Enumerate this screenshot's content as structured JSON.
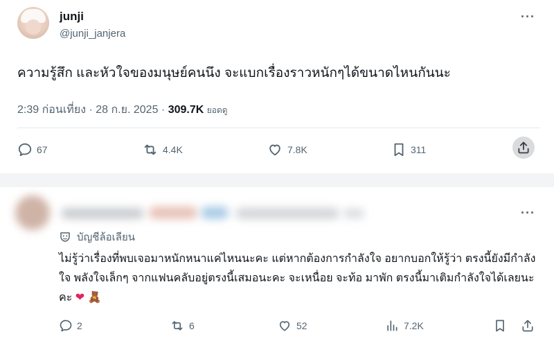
{
  "tweet": {
    "author_name": "junji",
    "author_handle": "@junji_janjera",
    "text": "ความรู้สึก และหัวใจของมนุษย์คนนึง จะแบกเรื่องราวหนักๆได้ขนาดไหนกันนะ",
    "timestamp": "2:39 ก่อนเที่ยง · 28 ก.ย. 2025 · ",
    "views_count": "309.7K",
    "views_label": "ยอดดู",
    "replies": "67",
    "retweets": "4.4K",
    "likes": "7.8K",
    "bookmarks": "311"
  },
  "reply": {
    "account_label": "บัญชีล้อเลียน",
    "text": "ไม่รู้ว่าเรื่องที่พบเจอมาหนักหนาแค่ไหนนะคะ แต่หากต้องการกำลังใจ อยากบอกให้รู้ว่า ตรงนี้ยังมีกำลังใจ พลังใจเล็กๆ จากแฟนคลับอยู่ตรงนี้เสมอนะคะ จะเหนื่อย จะท้อ มาพัก ตรงนี้มาเติมกำลังใจได้เลยนะคะ",
    "emojis": "❤ 🧸",
    "replies": "2",
    "retweets": "6",
    "likes": "52",
    "views": "7.2K"
  },
  "icons": {
    "more": "more-icon",
    "reply": "reply-icon",
    "retweet": "retweet-icon",
    "like": "heart-icon",
    "bookmark": "bookmark-icon",
    "share": "share-icon",
    "views": "views-icon",
    "parody": "parody-mask-icon"
  },
  "colors": {
    "text_primary": "#0f1419",
    "text_secondary": "#536471",
    "heart_red": "#e0245e"
  }
}
